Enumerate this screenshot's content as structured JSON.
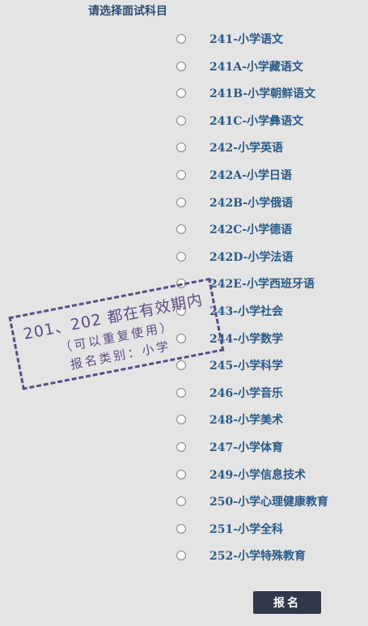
{
  "title": "请选择面试科目",
  "options": [
    "241-小学语文",
    "241A-小学藏语文",
    "241B-小学朝鲜语文",
    "241C-小学彝语文",
    "242-小学英语",
    "242A-小学日语",
    "242B-小学俄语",
    "242C-小学德语",
    "242D-小学法语",
    "242E-小学西班牙语",
    "243-小学社会",
    "244-小学数学",
    "245-小学科学",
    "246-小学音乐",
    "248-小学美术",
    "247-小学体育",
    "249-小学信息技术",
    "250-小学心理健康教育",
    "251-小学全科",
    "252-小学特殊教育"
  ],
  "stamp": {
    "line1": "201、202 都在有效期内",
    "line2": "（可以重复使用）",
    "line3": "报名类别：小学"
  },
  "submit_label": "报名"
}
